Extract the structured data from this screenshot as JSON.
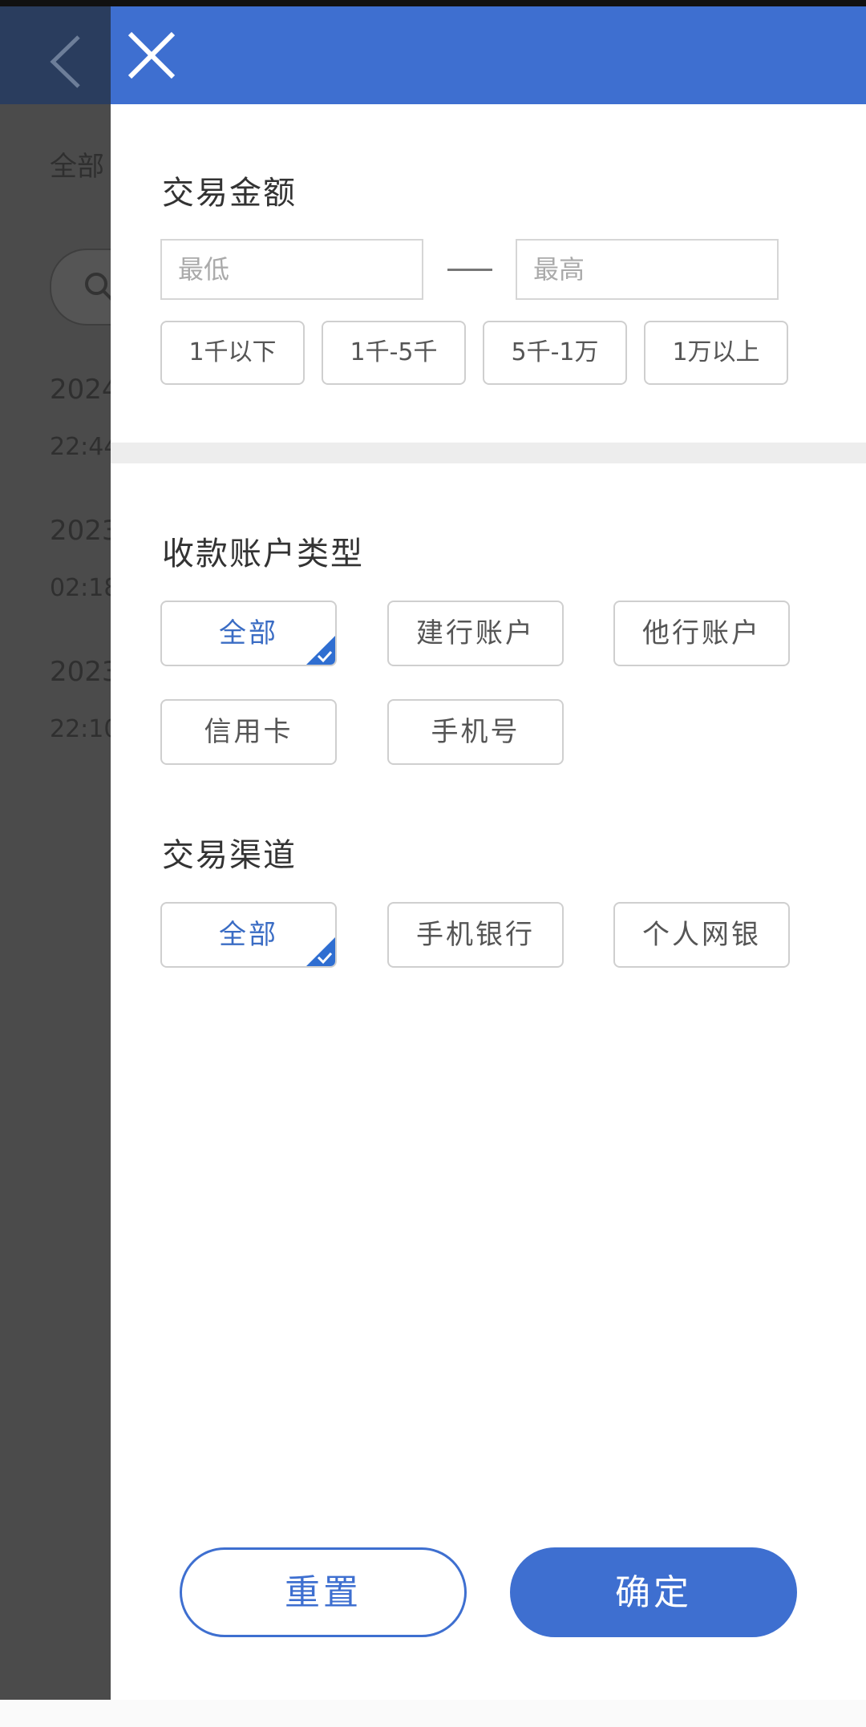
{
  "background_page": {
    "filter_label_partial": "全部",
    "records": [
      {
        "date_partial": "2024",
        "time_partial": "22:44"
      },
      {
        "date_partial": "2023",
        "time_partial": "02:18"
      },
      {
        "date_partial": "2023",
        "time_partial": "22:10"
      }
    ]
  },
  "drawer": {
    "amount_section": {
      "title": "交易金额",
      "min_placeholder": "最低",
      "max_placeholder": "最高",
      "quick_ranges": [
        "1千以下",
        "1千-5千",
        "5千-1万",
        "1万以上"
      ]
    },
    "account_type_section": {
      "title": "收款账户类型",
      "options": [
        "全部",
        "建行账户",
        "他行账户",
        "信用卡",
        "手机号"
      ],
      "selected": "全部"
    },
    "channel_section": {
      "title": "交易渠道",
      "options": [
        "全部",
        "手机银行",
        "个人网银"
      ],
      "selected": "全部"
    },
    "reset_label": "重置",
    "confirm_label": "确定"
  },
  "colors": {
    "accent": "#3e6fd0",
    "selected_text": "#3a6cc4",
    "overlay": "#4b4b4b"
  }
}
